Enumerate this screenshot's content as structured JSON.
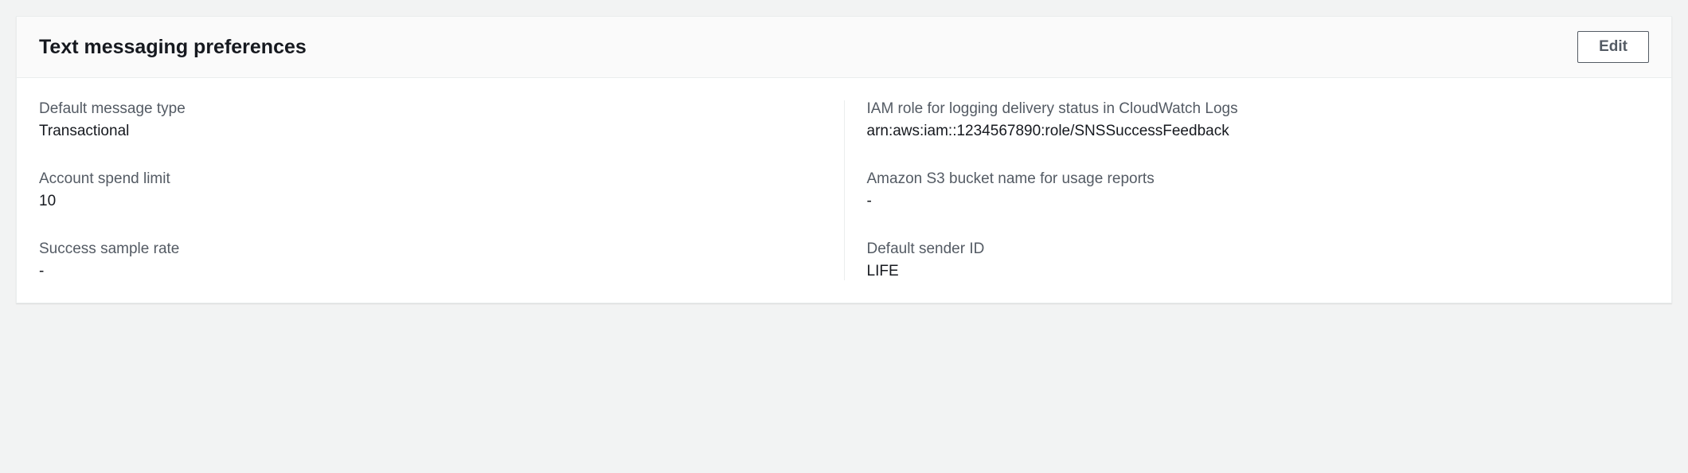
{
  "panel": {
    "title": "Text messaging preferences",
    "edit_label": "Edit"
  },
  "left": {
    "default_message_type": {
      "label": "Default message type",
      "value": "Transactional"
    },
    "account_spend_limit": {
      "label": "Account spend limit",
      "value": "10"
    },
    "success_sample_rate": {
      "label": "Success sample rate",
      "value": "-"
    }
  },
  "right": {
    "iam_role": {
      "label": "IAM role for logging delivery status in CloudWatch Logs",
      "value": "arn:aws:iam::1234567890:role/SNSSuccessFeedback"
    },
    "s3_bucket": {
      "label": "Amazon S3 bucket name for usage reports",
      "value": "-"
    },
    "default_sender_id": {
      "label": "Default sender ID",
      "value": "LIFE"
    }
  }
}
